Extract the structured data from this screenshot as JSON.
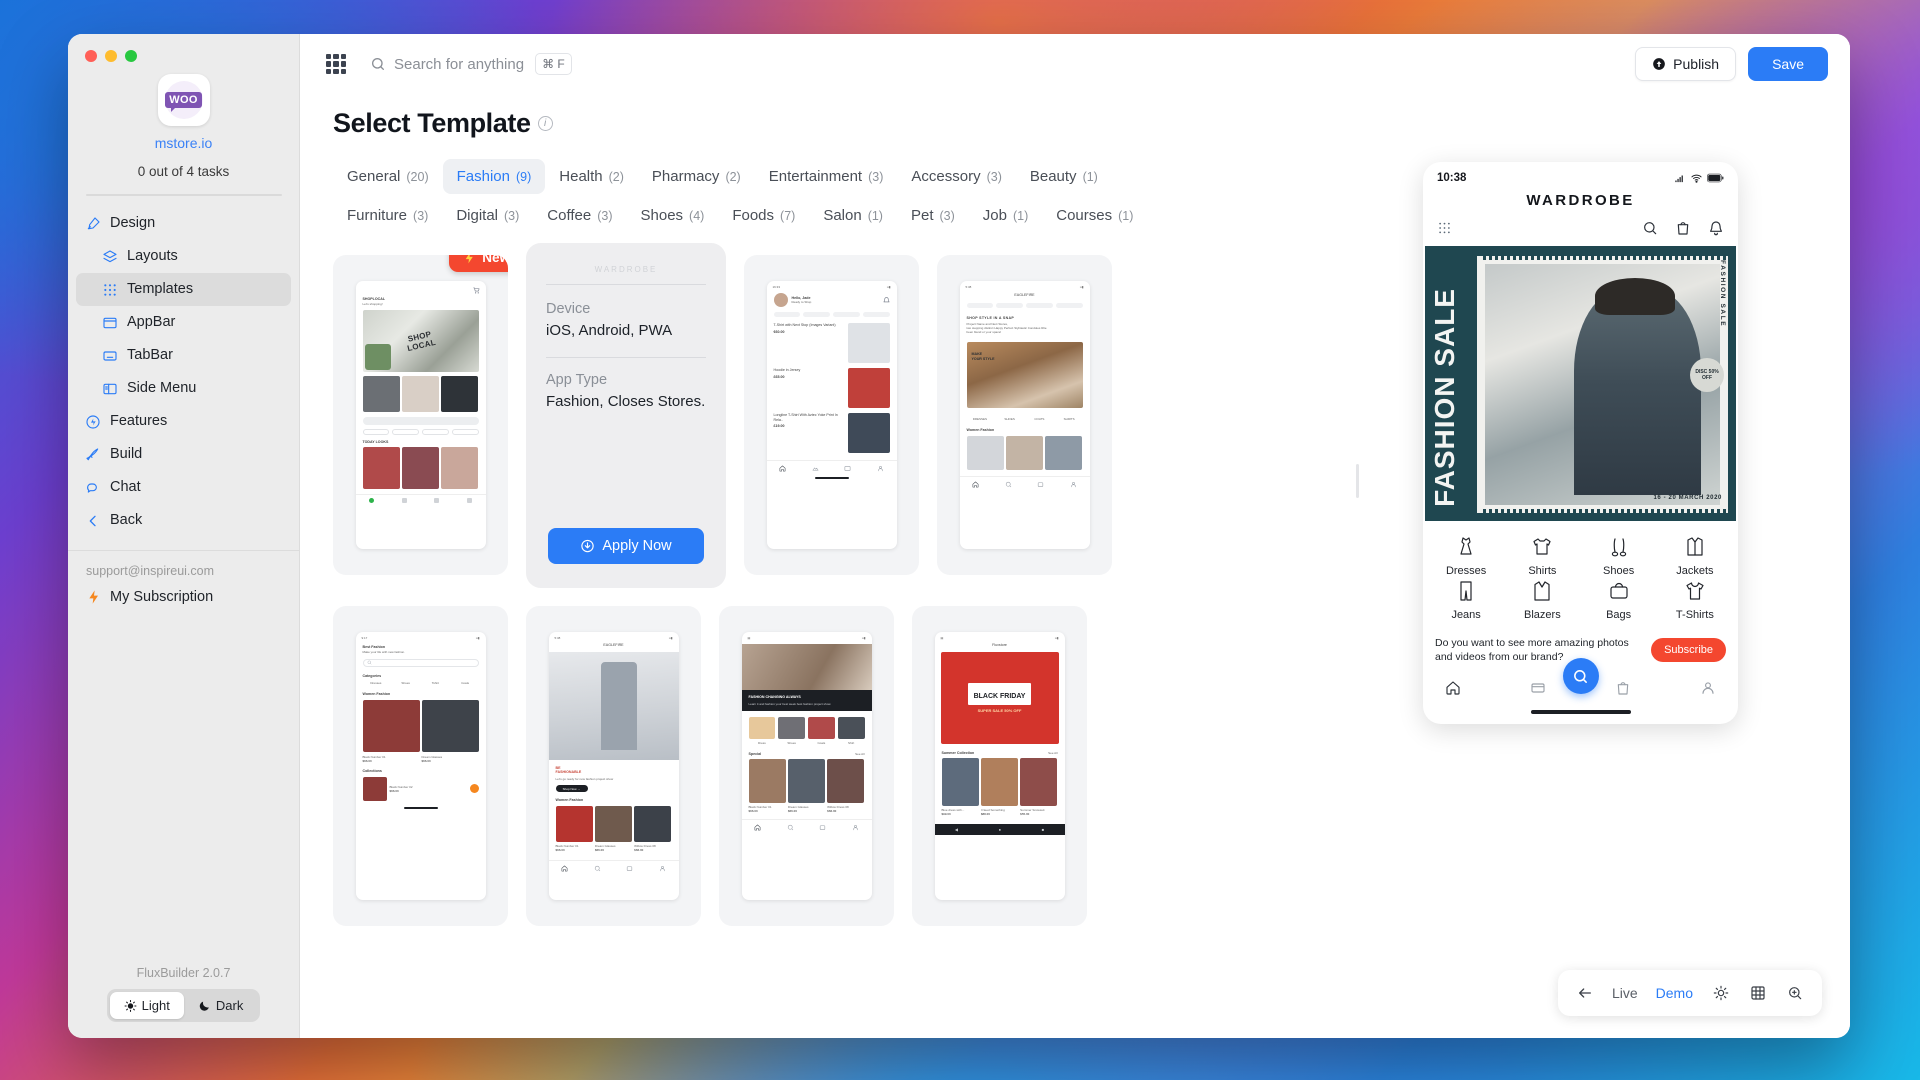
{
  "window": {
    "traffic_lights": [
      "close",
      "minimize",
      "zoom"
    ]
  },
  "sidebar": {
    "brand_icon": "woocommerce-logo",
    "brand_label": "WOO",
    "store_name": "mstore.io",
    "tasks": "0 out of 4 tasks",
    "items": [
      {
        "label": "Design",
        "icon": "design-icon",
        "level": 0,
        "active": false
      },
      {
        "label": "Layouts",
        "icon": "layers-icon",
        "level": 1,
        "active": false
      },
      {
        "label": "Templates",
        "icon": "grid-dots-icon",
        "level": 1,
        "active": true
      },
      {
        "label": "AppBar",
        "icon": "appbar-icon",
        "level": 1,
        "active": false
      },
      {
        "label": "TabBar",
        "icon": "tabbar-icon",
        "level": 1,
        "active": false
      },
      {
        "label": "Side Menu",
        "icon": "sidemenu-icon",
        "level": 1,
        "active": false
      },
      {
        "label": "Features",
        "icon": "features-icon",
        "level": 0,
        "active": false
      },
      {
        "label": "Build",
        "icon": "rocket-icon",
        "level": 0,
        "active": false
      },
      {
        "label": "Chat",
        "icon": "chat-icon",
        "level": 0,
        "active": false
      },
      {
        "label": "Back",
        "icon": "chevron-left-icon",
        "level": 0,
        "active": false
      }
    ],
    "support_email": "support@inspireui.com",
    "subscription_label": "My Subscription",
    "version": "FluxBuilder 2.0.7",
    "theme": {
      "light": "Light",
      "dark": "Dark",
      "selected": "Light"
    }
  },
  "topbar": {
    "apps_icon": "grid-apps-icon",
    "search_placeholder": "Search for anything",
    "search_shortcut": "⌘ F",
    "publish_label": "Publish",
    "save_label": "Save"
  },
  "page": {
    "title": "Select Template",
    "info_icon": "info-icon"
  },
  "tabs": [
    {
      "label": "General",
      "count": "(20)",
      "active": false
    },
    {
      "label": "Fashion",
      "count": "(9)",
      "active": true
    },
    {
      "label": "Health",
      "count": "(2)",
      "active": false
    },
    {
      "label": "Pharmacy",
      "count": "(2)",
      "active": false
    },
    {
      "label": "Entertainment",
      "count": "(3)",
      "active": false
    },
    {
      "label": "Accessory",
      "count": "(3)",
      "active": false
    },
    {
      "label": "Beauty",
      "count": "(1)",
      "active": false
    },
    {
      "label": "Furniture",
      "count": "(3)",
      "active": false
    },
    {
      "label": "Digital",
      "count": "(3)",
      "active": false
    },
    {
      "label": "Coffee",
      "count": "(3)",
      "active": false
    },
    {
      "label": "Shoes",
      "count": "(4)",
      "active": false
    },
    {
      "label": "Foods",
      "count": "(7)",
      "active": false
    },
    {
      "label": "Salon",
      "count": "(1)",
      "active": false
    },
    {
      "label": "Pet",
      "count": "(3)",
      "active": false
    },
    {
      "label": "Job",
      "count": "(1)",
      "active": false
    },
    {
      "label": "Courses",
      "count": "(1)",
      "active": false
    }
  ],
  "template_overlay": {
    "badge": {
      "label": "New",
      "icon": "bolt-icon"
    },
    "device_key": "Device",
    "device_value": "iOS, Android, PWA",
    "apptype_key": "App Type",
    "apptype_value": "Fashion, Closes Stores.",
    "apply_label": "Apply Now",
    "apply_icon": "download-circle-icon"
  },
  "template_cards": [
    {
      "name": "shop-local",
      "headline": "SHOP LOCAL",
      "sub": "SHOPLOCAL",
      "time": ""
    },
    {
      "name": "selected-overlay",
      "headline": "",
      "sub": "",
      "time": ""
    },
    {
      "name": "hello-jade",
      "headline": "Hello, Jade",
      "sub": "Ready to Shop",
      "time": "16:33"
    },
    {
      "name": "shop-style-snap",
      "headline": "SHOP STYLE IN A SNAP",
      "sub": "MAKE YOUR STYLE",
      "time": "5:38"
    },
    {
      "name": "best-fashion",
      "headline": "Best Fashion",
      "sub": "Make your life with new fashion.",
      "time": "9:17"
    },
    {
      "name": "be-fashionable",
      "headline": "BE FASHIONABLE",
      "sub": "Shop Now",
      "time": "5:38"
    },
    {
      "name": "fashion-changing-always",
      "headline": "FASHION CHANGING ALWAYS",
      "sub": "Special",
      "time": ""
    },
    {
      "name": "black-friday",
      "headline": "BLACK FRIDAY",
      "sub": "SUPER SALE 50% OFF",
      "time": ""
    }
  ],
  "preview": {
    "status_time": "10:38",
    "status_icons": [
      "signal-icon",
      "wifi-icon",
      "battery-icon"
    ],
    "app_title": "WARDROBE",
    "appbar_icons": [
      "grid-dots-icon",
      "search-icon",
      "bag-icon",
      "bell-icon"
    ],
    "hero": {
      "big_text": "FASHION SALE",
      "side_text": "FASHION SALE",
      "badge": "DISC 50% OFF",
      "date": "16 - 20 MARCH 2020",
      "bg_color": "#1f4750"
    },
    "categories": [
      {
        "label": "Dresses",
        "icon": "dress-icon"
      },
      {
        "label": "Shirts",
        "icon": "shirt-icon"
      },
      {
        "label": "Shoes",
        "icon": "shoes-icon"
      },
      {
        "label": "Jackets",
        "icon": "jacket-icon"
      },
      {
        "label": "Jeans",
        "icon": "jeans-icon"
      },
      {
        "label": "Blazers",
        "icon": "blazer-icon"
      },
      {
        "label": "Bags",
        "icon": "bag-icon"
      },
      {
        "label": "T-Shirts",
        "icon": "tshirt-icon"
      }
    ],
    "promo_text": "Do you want to see more amazing photos and videos from our brand?",
    "promo_button": "Subscribe",
    "promo_color": "#f4472f",
    "tabbar_icons": [
      "home-icon",
      "card-icon",
      "search-fab-icon",
      "bag-icon",
      "person-icon"
    ]
  },
  "floatbar": {
    "back_icon": "arrow-left-icon",
    "live_label": "Live",
    "demo_label": "Demo",
    "selected": "Demo",
    "icons": [
      "sun-icon",
      "grid-icon",
      "zoom-icon"
    ]
  },
  "colors": {
    "accent": "#2b7cf6",
    "danger": "#f4472f",
    "sidebar": "#ececec",
    "hero": "#1f4750"
  }
}
